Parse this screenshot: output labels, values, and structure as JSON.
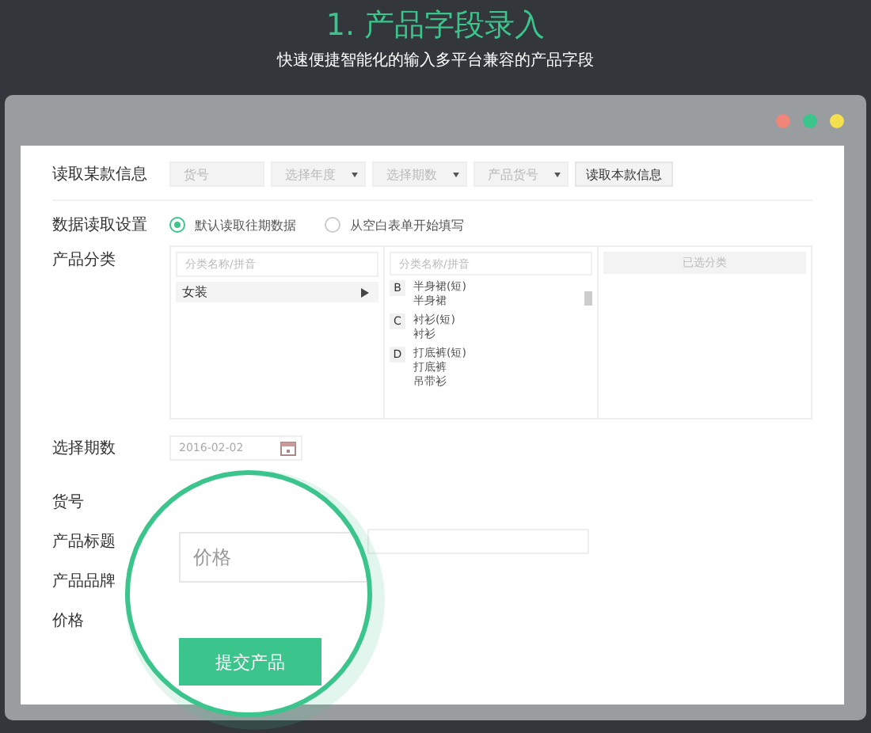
{
  "header": {
    "title": "1. 产品字段录入",
    "subtitle": "快速便捷智能化的输入多平台兼容的产品字段"
  },
  "window": {
    "controls": [
      {
        "color": "#f0857a"
      },
      {
        "color": "#3cc48d"
      },
      {
        "color": "#f4e04d"
      }
    ]
  },
  "read_row": {
    "label": "读取某款信息",
    "fields": [
      {
        "kind": "text",
        "placeholder": "货号"
      },
      {
        "kind": "select",
        "placeholder": "选择年度"
      },
      {
        "kind": "select",
        "placeholder": "选择期数"
      },
      {
        "kind": "select",
        "placeholder": "产品货号"
      }
    ],
    "button": "读取本款信息"
  },
  "read_setting": {
    "label": "数据读取设置",
    "options": [
      {
        "label": "默认读取往期数据",
        "selected": true
      },
      {
        "label": "从空白表单开始填写",
        "selected": false
      }
    ]
  },
  "category": {
    "label": "产品分类",
    "column_1": {
      "placeholder": "分类名称/拼音",
      "items": [
        {
          "label": "女装"
        }
      ]
    },
    "column_2": {
      "placeholder": "分类名称/拼音",
      "groups": [
        {
          "letter": "B",
          "items": [
            "半身裙(短)",
            "半身裙"
          ]
        },
        {
          "letter": "C",
          "items": [
            "衬衫(短)",
            "衬衫"
          ]
        },
        {
          "letter": "D",
          "items": [
            "打底裤(短)",
            "打底裤",
            "吊带衫"
          ]
        }
      ]
    },
    "column_3": {
      "title": "已选分类"
    }
  },
  "period": {
    "label": "选择期数",
    "value": "2016-02-02"
  },
  "fields": [
    {
      "label": "货号",
      "kind": "none"
    },
    {
      "label": "产品标题",
      "kind": "input"
    },
    {
      "label": "产品品牌",
      "kind": "none"
    },
    {
      "label": "价格",
      "kind": "none"
    }
  ],
  "magnifier": {
    "price_placeholder": "价格",
    "submit": "提交产品"
  }
}
